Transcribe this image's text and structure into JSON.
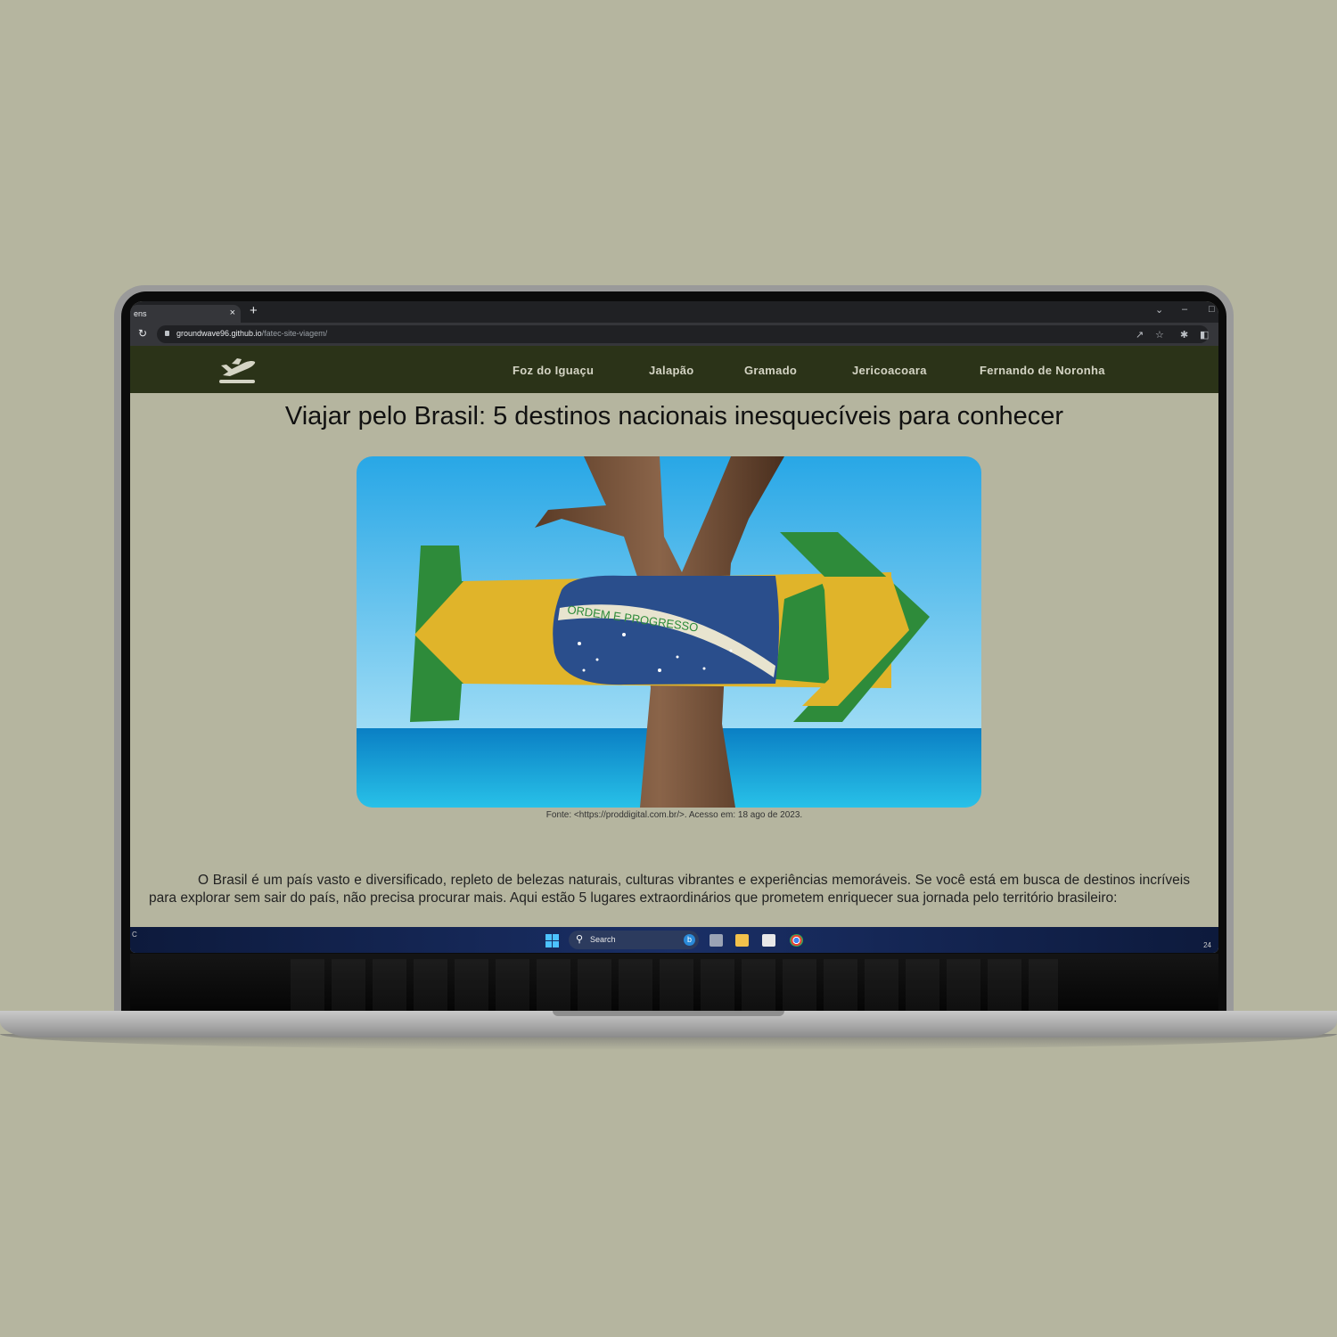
{
  "browser": {
    "tab_title": "ens",
    "tab_close": "×",
    "new_tab": "+",
    "url_host": "groundwave96.github.io",
    "url_path": "/fatec-site-viagem/"
  },
  "nav": {
    "links": [
      "Foz do Iguaçu",
      "Jalapão",
      "Gramado",
      "Jericoacoara",
      "Fernando de Noronha"
    ]
  },
  "article": {
    "title": "Viajar pelo Brasil: 5 destinos nacionais inesquecíveis para conhecer",
    "image_caption": "Fonte: <https://proddigital.com.br/>. Acesso em: 18 ago de 2023.",
    "flag_motto": "ORDEM E PROGRESSO",
    "intro": "O Brasil é um país vasto e diversificado, repleto de belezas naturais, culturas vibrantes e experiências memoráveis. Se você está em busca de destinos incríveis para explorar sem sair do país, não precisa procurar mais. Aqui estão 5 lugares extraordinários que prometem enriquecer sua jornada pelo território brasileiro:"
  },
  "taskbar": {
    "search_placeholder": "Search",
    "tray_left": "C",
    "tray_time": "24"
  },
  "colors": {
    "page_bg": "#b5b59f",
    "nav_bg": "#2b3318",
    "nav_text": "#d4d4c4",
    "flag_green": "#2e8b3a",
    "flag_yellow": "#e0b42a",
    "flag_blue": "#2a4e8c"
  }
}
